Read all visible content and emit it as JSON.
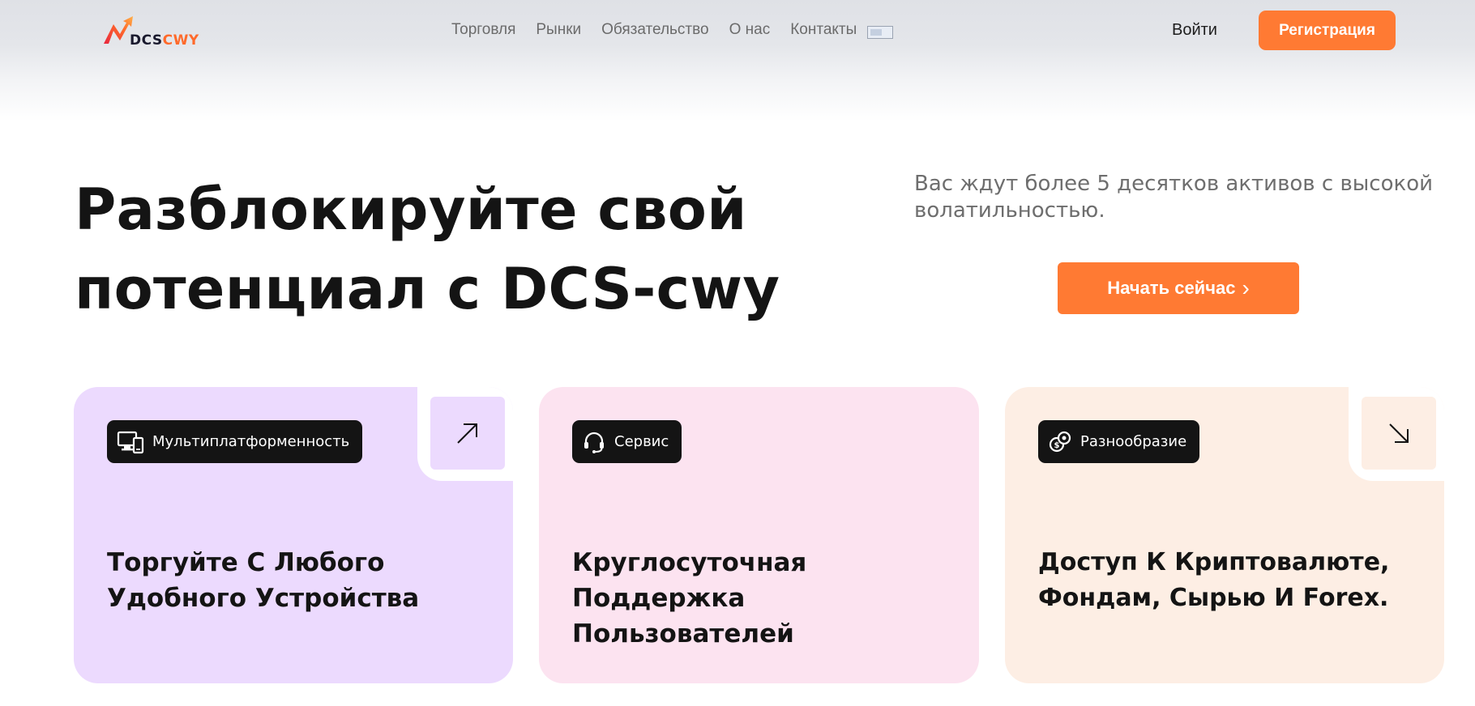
{
  "header": {
    "logo": {
      "dcs": "DCS",
      "cwy": "CWY"
    },
    "nav": [
      "Торговля",
      "Рынки",
      "Обязательство",
      "О нас",
      "Контакты"
    ],
    "login_label": "Войти",
    "register_label": "Регистрация"
  },
  "hero": {
    "title_line1": "Разблокируйте свой",
    "title_line2": "потенциал с DCS-cwy",
    "subtitle": "Вас ждут более 5 десятков активов с высокой волатильностью.",
    "cta_label": "Начать сейчас",
    "cta_chevron": "›"
  },
  "cards": [
    {
      "tag": "Мультиплатформенность",
      "icon": "devices-icon",
      "title": "Торгуйте С Любого Удобного Устройства",
      "arrow": "arrow-up-right-icon"
    },
    {
      "tag": "Сервис",
      "icon": "headset-icon",
      "title": "Круглосуточная Поддержка Пользователей"
    },
    {
      "tag": "Разнообразие",
      "icon": "coins-icon",
      "title": "Доступ К Криптовалюте, Фондам, Сырью И Forex.",
      "arrow": "arrow-down-right-icon"
    }
  ],
  "colors": {
    "accent": "#ff7a33",
    "card1_bg": "#ecdafe",
    "card2_bg": "#fce3f0",
    "card3_bg": "#fdeee4",
    "tag_bg": "#141414"
  }
}
